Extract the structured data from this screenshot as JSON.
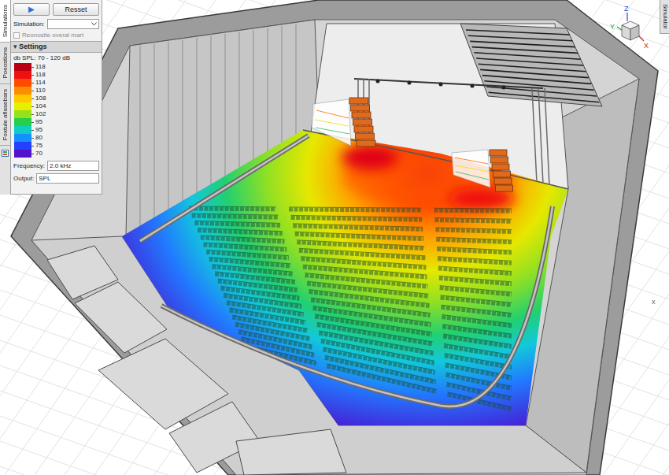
{
  "side_tabs": [
    {
      "label": "Simulations",
      "selected": true
    },
    {
      "label": "Poeostions",
      "selected": false
    },
    {
      "label": "Foxtule aflasebars",
      "selected": false
    }
  ],
  "right_tab": {
    "label": "Smulator"
  },
  "toolbar": {
    "play_icon": "▶",
    "reset": "Resset"
  },
  "simulation": {
    "label": "Simulation:"
  },
  "checkbox": {
    "label": "Reonosite overal mart",
    "checked": false,
    "disabled": true
  },
  "settings": {
    "toggle_icon": "▾",
    "header": "Settings",
    "expanded": true,
    "scale_label": "db SPL: 70 - 120 dB",
    "legend": [
      {
        "value": "118",
        "color": "#b80012"
      },
      {
        "value": "118",
        "color": "#f01010"
      },
      {
        "value": "114",
        "color": "#ff4a00"
      },
      {
        "value": "110",
        "color": "#ff8c00"
      },
      {
        "value": "108",
        "color": "#ffc800"
      },
      {
        "value": "104",
        "color": "#e8ee00"
      },
      {
        "value": "102",
        "color": "#96e01e"
      },
      {
        "value": "95",
        "color": "#24d04a"
      },
      {
        "value": "95",
        "color": "#10cdc4"
      },
      {
        "value": "80",
        "color": "#1490ff"
      },
      {
        "value": "75",
        "color": "#2440ff"
      },
      {
        "value": "70",
        "color": "#5212c8"
      }
    ],
    "frequency": {
      "label": "Frequency:",
      "value": "2.0 kHz"
    },
    "output": {
      "label": "Output:",
      "value": "SPL"
    }
  },
  "view": {
    "axes": [
      "Z",
      "Y",
      "X"
    ],
    "ground_axis": "x"
  }
}
